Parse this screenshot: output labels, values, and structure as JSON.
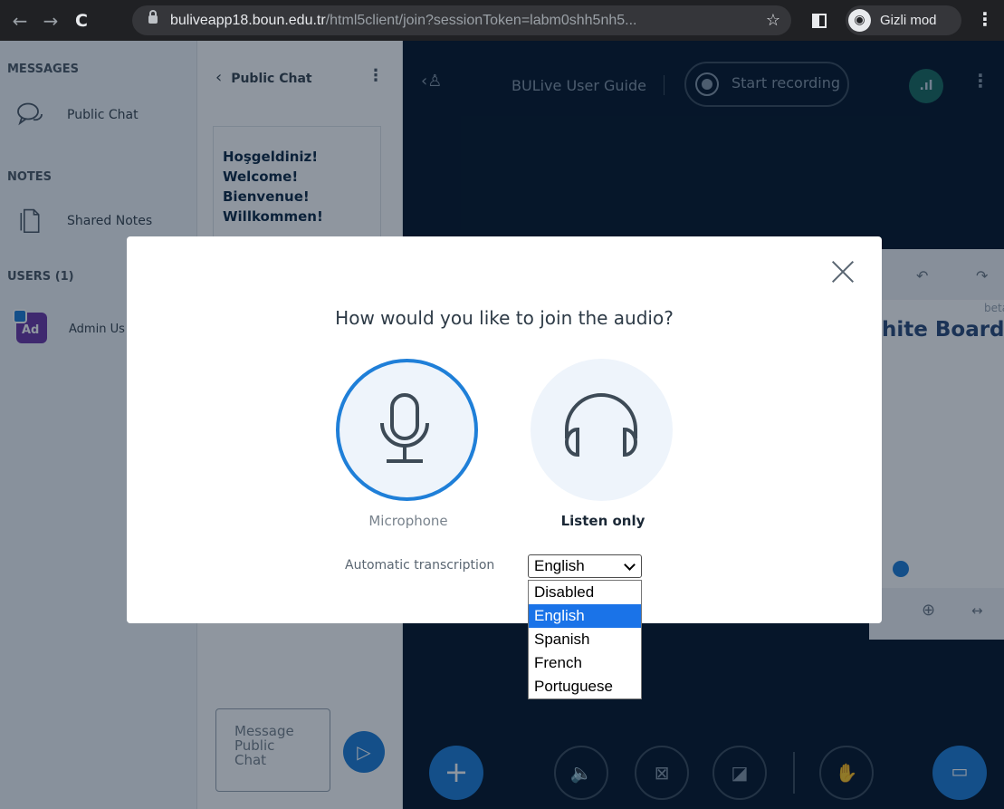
{
  "browser": {
    "url_host": "buliveapp18.boun.edu.tr",
    "url_path": "/html5client/join?sessionToken=labm0shh5nh5...",
    "profile_label": "Gizli mod"
  },
  "sidebar": {
    "messages_title": "MESSAGES",
    "public_chat_label": "Public Chat",
    "notes_title": "NOTES",
    "shared_notes_label": "Shared Notes",
    "users_title": "USERS (1)",
    "user_initials": "Ad",
    "user_name": "Admin Us"
  },
  "chat": {
    "title": "Public Chat",
    "welcome_lines": [
      "Hoşgeldiniz!",
      "Welcome!",
      "Bienvenue!",
      "Willkommen!"
    ],
    "message_placeholder": [
      "Message",
      "Public",
      "Chat"
    ]
  },
  "main": {
    "room_title": "BULive User Guide",
    "record_label": "Start recording",
    "whiteboard_title": "hite Board",
    "whiteboard_beta": "beta"
  },
  "modal": {
    "title": "How would you like to join the audio?",
    "microphone_label": "Microphone",
    "listen_label": "Listen only",
    "transcription_label": "Automatic transcription",
    "transcription_selected": "English",
    "transcription_options": [
      "Disabled",
      "English",
      "Spanish",
      "French",
      "Portuguese"
    ]
  },
  "colors": {
    "accent": "#1f7fd8",
    "dark_bg": "#06172a",
    "select_highlight": "#1a73e8"
  }
}
